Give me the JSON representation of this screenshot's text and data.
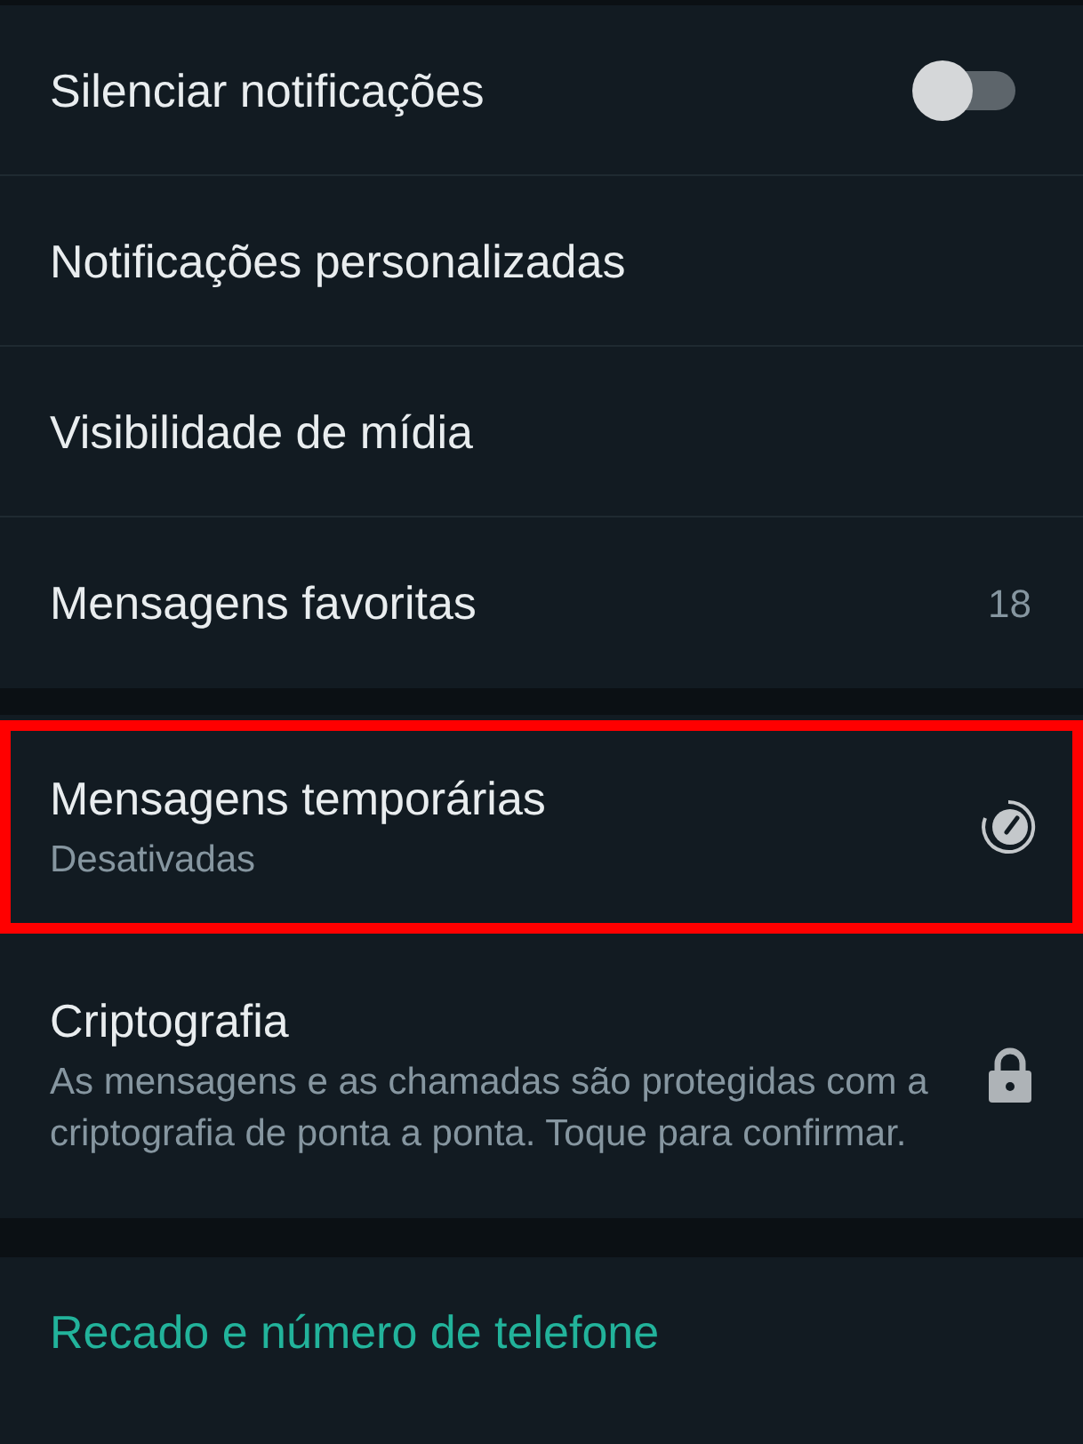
{
  "sections": [
    {
      "items": [
        {
          "kind": "toggle",
          "label": "Silenciar notificações",
          "on": false
        },
        {
          "kind": "plain",
          "label": "Notificações personalizadas"
        },
        {
          "kind": "plain",
          "label": "Visibilidade de mídia"
        },
        {
          "kind": "count",
          "label": "Mensagens favoritas",
          "count": "18"
        }
      ]
    },
    {
      "items": [
        {
          "kind": "timer",
          "label": "Mensagens temporárias",
          "subtitle": "Desativadas",
          "highlighted": true
        },
        {
          "kind": "lock",
          "label": "Criptografia",
          "subtitle": "As mensagens e as chamadas são protegidas com a criptografia de ponta a ponta. Toque para confirmar.",
          "highlighted": false
        }
      ]
    },
    {
      "items": [
        {
          "kind": "link",
          "label": "Recado e número de telefone"
        }
      ]
    }
  ]
}
